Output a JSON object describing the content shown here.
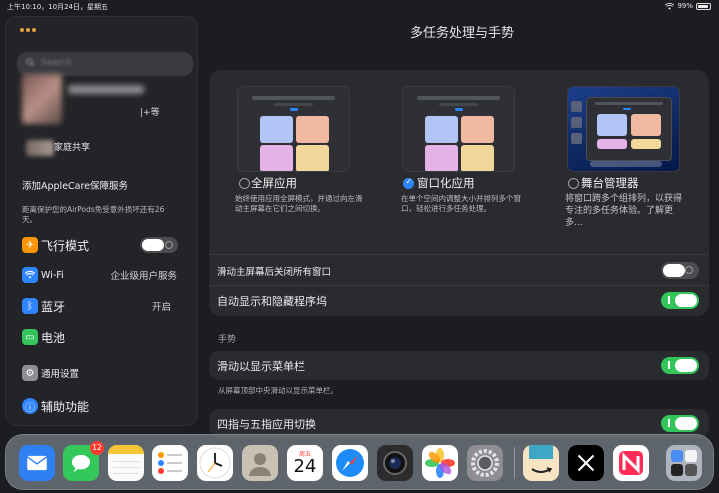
{
  "status_bar": {
    "time_date": "上午10:10，10月24日，星期五",
    "battery": "99%"
  },
  "sidebar": {
    "search_placeholder": "Search",
    "profile_suffix": "|+等",
    "family_label": "家庭共享",
    "applecare": "添加AppleCare保障服务",
    "airpods_note": "距离保护您的AirPods免受意外损坏还有26天。",
    "items": [
      {
        "label": "飞行模式",
        "icon": "airplane-icon",
        "color": "#ff9500",
        "value": ""
      },
      {
        "label": "Wi-Fi",
        "icon": "wifi-icon",
        "color": "#2f84ff",
        "value": "企业级用户服务"
      },
      {
        "label": "蓝牙",
        "icon": "bluetooth-icon",
        "color": "#2f84ff",
        "value": "开启"
      },
      {
        "label": "电池",
        "icon": "battery-icon",
        "color": "#33c55a",
        "value": ""
      },
      {
        "label": "通用设置",
        "icon": "gear-icon",
        "color": "#8e8e93",
        "value": ""
      },
      {
        "label": "辅助功能",
        "icon": "accessibility-icon",
        "color": "#2f84ff",
        "value": ""
      }
    ]
  },
  "main": {
    "title": "多任务处理与手势",
    "options": [
      {
        "label": "全屏应用",
        "selected": false,
        "desc": "始终使用应用全屏模式，并通过向左滑动主屏幕在它们之间切换。"
      },
      {
        "label": "窗口化应用",
        "selected": true,
        "desc": "在单个空间内调整大小并排列多个窗口，轻松进行多任务处理。"
      },
      {
        "label": "舞台管理器",
        "selected": false,
        "desc": "将窗口跨多个组排列，以获得专注的多任务体验。了解更多..."
      }
    ],
    "rows": [
      {
        "label": "滑动主屏幕后关闭所有窗口",
        "on": false
      },
      {
        "label": "自动显示和隐藏程序坞",
        "on": true
      }
    ],
    "gestures_header": "手势",
    "gesture_row": {
      "label": "滑动以显示菜单栏",
      "on": true
    },
    "gesture_desc": "从屏幕顶部中央滑动以显示菜单栏。",
    "gesture_row2": {
      "label": "四指与五指应用切换",
      "on": true
    }
  },
  "dock": {
    "apps": [
      {
        "name": "mail-app-icon",
        "bg": "#2f7ff5",
        "glyph": "✉"
      },
      {
        "name": "messages-app-icon",
        "bg": "#34c759",
        "glyph": "💬",
        "badge": "12"
      },
      {
        "name": "notes-app-icon",
        "bg": "#fbfbfb",
        "glyph": ""
      },
      {
        "name": "reminders-app-icon",
        "bg": "#ffffff",
        "glyph": ""
      },
      {
        "name": "clock-app-icon",
        "bg": "#ffffff",
        "glyph": ""
      },
      {
        "name": "contacts-app-icon",
        "bg": "#c9c2b4",
        "glyph": "👤"
      },
      {
        "name": "calendar-app-icon",
        "bg": "#ffffff",
        "glyph": ""
      },
      {
        "name": "safari-app-icon",
        "bg": "#ffffff",
        "glyph": "🧭"
      },
      {
        "name": "camera-app-icon",
        "bg": "#2c2c2e",
        "glyph": ""
      },
      {
        "name": "photos-app-icon",
        "bg": "#ffffff",
        "glyph": "✿"
      },
      {
        "name": "settings-app-icon",
        "bg": "#8e8e93",
        "glyph": "⚙"
      },
      {
        "name": "amazon-app-icon",
        "bg": "#f7e4c2",
        "glyph": ""
      },
      {
        "name": "x-app-icon",
        "bg": "#000000",
        "glyph": "𝕏"
      },
      {
        "name": "news-app-icon",
        "bg": "#ffffff",
        "glyph": ""
      },
      {
        "name": "app-library-icon",
        "bg": "rgba(210,215,225,0.7)",
        "glyph": ""
      }
    ],
    "calendar_day": "24",
    "calendar_weekday": "周五"
  }
}
